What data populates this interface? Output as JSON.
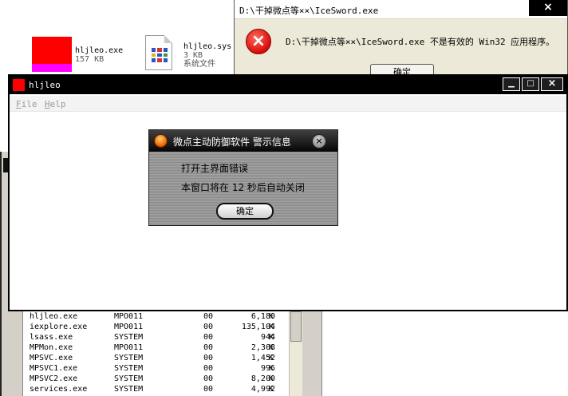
{
  "desktop": {
    "files": [
      {
        "name": "hljleo.exe",
        "size": "157 KB"
      },
      {
        "name": "hljleo.sys",
        "size": "3 KB",
        "type": "系统文件"
      }
    ]
  },
  "error_dialog": {
    "title": "D:\\干掉微点等××\\IceSword.exe",
    "close_label": "×",
    "message": "D:\\干掉微点等××\\IceSword.exe 不是有效的 Win32 应用程序。",
    "ok_label": "确定",
    "icon": "error-icon"
  },
  "process_list": {
    "rows": [
      {
        "name": "hljleo.exe",
        "user": "MPO011",
        "cpu": "00",
        "mem": "6,180",
        "unit": "K"
      },
      {
        "name": "iexplore.exe",
        "user": "MPO011",
        "cpu": "00",
        "mem": "135,104",
        "unit": "K"
      },
      {
        "name": "lsass.exe",
        "user": "SYSTEM",
        "cpu": "00",
        "mem": "944",
        "unit": "K"
      },
      {
        "name": "MPMon.exe",
        "user": "MPO011",
        "cpu": "00",
        "mem": "2,308",
        "unit": "K"
      },
      {
        "name": "MPSVC.exe",
        "user": "SYSTEM",
        "cpu": "00",
        "mem": "1,452",
        "unit": "K"
      },
      {
        "name": "MPSVC1.exe",
        "user": "SYSTEM",
        "cpu": "00",
        "mem": "996",
        "unit": "K"
      },
      {
        "name": "MPSVC2.exe",
        "user": "SYSTEM",
        "cpu": "00",
        "mem": "8,200",
        "unit": "K"
      },
      {
        "name": "services.exe",
        "user": "SYSTEM",
        "cpu": "00",
        "mem": "4,992",
        "unit": "K"
      }
    ]
  },
  "main_window": {
    "title": "hljleo",
    "controls": {
      "minimize": "▁",
      "maximize": "□",
      "close": "×"
    },
    "menu": [
      {
        "mnemonic": "F",
        "rest": "ile"
      },
      {
        "mnemonic": "H",
        "rest": "elp"
      }
    ]
  },
  "alert": {
    "title": "微点主动防御软件  警示信息",
    "close_label": "×",
    "line1": "打开主界面错误",
    "line2": "本窗口将在 12 秒后自动关闭",
    "ok_label": "确定"
  },
  "colors": {
    "error_red": "#d80b0b",
    "app_icon_red": "#ff0000",
    "alert_orb_orange": "#f26a00"
  }
}
